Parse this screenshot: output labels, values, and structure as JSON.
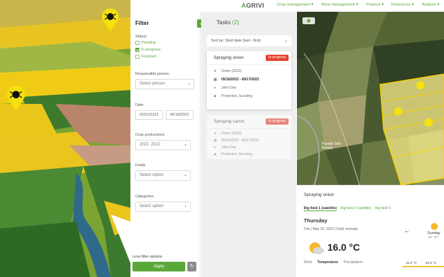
{
  "app": {
    "brand_prefix": "A",
    "brand_rest": "GRIVI"
  },
  "nav": [
    {
      "label": "Crop management ▾"
    },
    {
      "label": "Wine management ▾"
    },
    {
      "label": "Finance ▾"
    },
    {
      "label": "Resources ▾"
    },
    {
      "label": "Analyze ▾"
    }
  ],
  "filter": {
    "title": "Filter",
    "back_icon": "‹",
    "status_label": "Status:",
    "statuses": [
      {
        "label": "Pending",
        "checked": false
      },
      {
        "label": "In progress",
        "checked": true
      },
      {
        "label": "Finished",
        "checked": false
      }
    ],
    "responsible_label": "Responsible person",
    "responsible_placeholder": "Select person",
    "date_label": "Date",
    "date_from": "02/01/2022",
    "date_to": "05/18/2022",
    "crop_label": "Crop productions",
    "crop_value": "2022, 2022",
    "fields_label": "Fields",
    "fields_placeholder": "Select option",
    "categories_label": "Categories",
    "categories_placeholder": "Select option",
    "less_options": "Less filter options",
    "apply": "Apply",
    "reset_icon": "↻"
  },
  "tasks": {
    "title": "Tasks",
    "count": "(2)",
    "sort_label": "Sort by: Start date (last - first)",
    "cards": [
      {
        "name": "Spraying onion",
        "status": "In progress",
        "status_color": "#e2422f",
        "crop": "Onion (2022)",
        "dates": "05/16/2022 - 05/17/2022",
        "person": "John Doe",
        "categories": "Protection, Scouting"
      },
      {
        "name": "Spraying carrot",
        "status": "In progress",
        "status_color": "#e2422f",
        "crop": "Onion (2022)",
        "dates": "05/16/2022 - 05/17/2022",
        "person": "John Doe",
        "categories": "Protection, Scouting"
      }
    ]
  },
  "map": {
    "town_label": "Pasinje Selo Borovo"
  },
  "weather": {
    "task_name": "Spraying onion",
    "tabs": [
      "Big field 1 (satellite)",
      "Big field 2 (satellite)",
      "Big field 4"
    ],
    "day": "Thursday",
    "meta": "Fair  |  May 19, 2022  |  Daily average",
    "temp": "16.0 °C",
    "options": [
      "Wind",
      "Temperature",
      "Precipitation"
    ],
    "next_day": "Sunday",
    "next_range": "12° 27°",
    "graph_a": "11.0 °C",
    "graph_b": "10.0 °C"
  }
}
